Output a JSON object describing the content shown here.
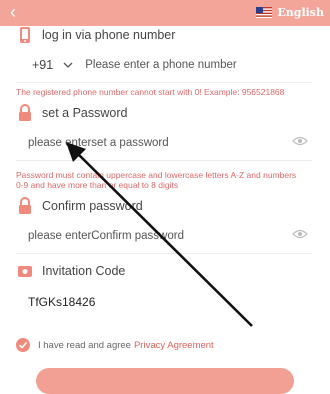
{
  "header": {
    "language": "English"
  },
  "phone_login": {
    "label": "log in via phone number",
    "country_code": "+91",
    "placeholder": "Please enter a phone number",
    "warning": "The registered phone number cannot start with 0! Example: 956521868"
  },
  "password": {
    "label": "set a Password",
    "placeholder": "please enterset a password",
    "warning": "Password must contain uppercase and lowercase letters A-Z and numbers 0-9 and have more than or equal to 8 digits"
  },
  "confirm_password": {
    "label": "Confirm password",
    "placeholder": "please enterConfirm password"
  },
  "invitation": {
    "label": "Invitation Code",
    "value": "TfGKs18426"
  },
  "agreement": {
    "text": "I have read and agree",
    "link": "Privacy Agreement"
  },
  "colors": {
    "accent": "#f4a59a",
    "warning": "#e06a6a",
    "link": "#e0635b"
  }
}
